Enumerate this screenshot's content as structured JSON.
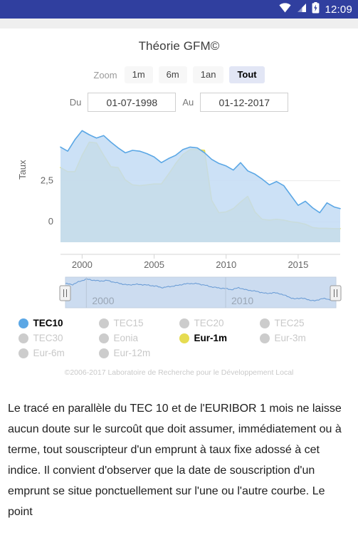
{
  "statusbar": {
    "time": "12:09",
    "icons": [
      "wifi-icon",
      "signal-icon",
      "battery-charging-icon"
    ],
    "background": "#303f9f"
  },
  "chart_card": {
    "title": "Théorie GFM©",
    "rangeselector": {
      "label": "Zoom",
      "buttons": [
        {
          "label": "1m",
          "active": false
        },
        {
          "label": "6m",
          "active": false
        },
        {
          "label": "1an",
          "active": false
        },
        {
          "label": "Tout",
          "active": true
        }
      ]
    },
    "date_inputs": {
      "from_label": "Du",
      "from_value": "01-07-1998",
      "to_label": "Au",
      "to_value": "01-12-2017"
    },
    "legend": {
      "items": [
        {
          "label": "TEC10",
          "active": true,
          "color": "#5ba7e5"
        },
        {
          "label": "TEC15",
          "active": false,
          "color": "#cccccc"
        },
        {
          "label": "TEC20",
          "active": false,
          "color": "#cccccc"
        },
        {
          "label": "TEC25",
          "active": false,
          "color": "#cccccc"
        },
        {
          "label": "TEC30",
          "active": false,
          "color": "#cccccc"
        },
        {
          "label": "Eonia",
          "active": false,
          "color": "#cccccc"
        },
        {
          "label": "Eur-1m",
          "active": true,
          "color": "#e6dc51"
        },
        {
          "label": "Eur-3m",
          "active": false,
          "color": "#cccccc"
        },
        {
          "label": "Eur-6m",
          "active": false,
          "color": "#cccccc"
        },
        {
          "label": "Eur-12m",
          "active": false,
          "color": "#cccccc"
        }
      ]
    },
    "credits": "©2006-2017 Laboratoire de Recherche pour le Développement Local",
    "navigator": {
      "tick_labels": [
        "2000",
        "2010"
      ],
      "left_handle": "navigator-handle-left",
      "right_handle": "navigator-handle-right"
    }
  },
  "chart_data": {
    "type": "area",
    "title": "Théorie GFM©",
    "xlabel": "",
    "ylabel": "Taux",
    "ylim": [
      -1.25,
      6.0
    ],
    "xlim": [
      1998.5,
      2017.92
    ],
    "yticks": [
      0,
      2.5
    ],
    "ytick_labels": [
      "0",
      "2,5"
    ],
    "xticks": [
      2000,
      2005,
      2010,
      2015
    ],
    "xtick_labels": [
      "2000",
      "2005",
      "2010",
      "2015"
    ],
    "grid": true,
    "legend_position": "bottom",
    "x": [
      1998.5,
      1999.0,
      1999.5,
      2000.0,
      2000.5,
      2001.0,
      2001.5,
      2002.0,
      2002.5,
      2003.0,
      2003.5,
      2004.0,
      2004.5,
      2005.0,
      2005.5,
      2006.0,
      2006.5,
      2007.0,
      2007.5,
      2008.0,
      2008.5,
      2009.0,
      2009.5,
      2010.0,
      2010.5,
      2011.0,
      2011.5,
      2012.0,
      2012.5,
      2013.0,
      2013.5,
      2014.0,
      2014.5,
      2015.0,
      2015.5,
      2016.0,
      2016.5,
      2017.0,
      2017.5,
      2017.92
    ],
    "series": [
      {
        "name": "TEC10",
        "color": "#5ba7e5",
        "fill": "#c3dcf5",
        "values": [
          4.55,
          4.3,
          5.0,
          5.55,
          5.3,
          5.1,
          5.25,
          4.85,
          4.5,
          4.2,
          4.35,
          4.3,
          4.15,
          3.95,
          3.6,
          3.85,
          4.05,
          4.4,
          4.55,
          4.5,
          4.2,
          3.8,
          3.55,
          3.4,
          3.15,
          3.6,
          3.1,
          2.9,
          2.6,
          2.25,
          2.45,
          2.2,
          1.6,
          1.0,
          1.25,
          0.85,
          0.55,
          1.15,
          0.9,
          0.8
        ]
      },
      {
        "name": "Eur-1m",
        "color": "#e6dc51",
        "fill": "#d8dba8",
        "values": [
          3.3,
          3.05,
          3.05,
          4.05,
          4.85,
          4.8,
          4.05,
          3.35,
          3.3,
          2.55,
          2.25,
          2.2,
          2.25,
          2.3,
          2.3,
          2.9,
          3.55,
          4.1,
          4.4,
          4.4,
          4.35,
          1.3,
          0.55,
          0.6,
          0.8,
          1.2,
          1.55,
          0.6,
          0.15,
          0.1,
          0.15,
          0.1,
          0.0,
          -0.05,
          -0.15,
          -0.35,
          -0.4,
          -0.4,
          -0.42,
          -0.42
        ]
      }
    ]
  },
  "article": {
    "paragraph": "Le tracé en parallèle du TEC 10 et de l'EURIBOR 1 mois ne laisse aucun doute sur le surcoût que doit assumer, immédiatement ou à terme, tout souscripteur d'un emprunt à taux fixe adossé à cet indice. Il convient d'observer que la date de souscription d'un emprunt se situe ponctuellement sur l'une ou l'autre courbe. Le point"
  }
}
